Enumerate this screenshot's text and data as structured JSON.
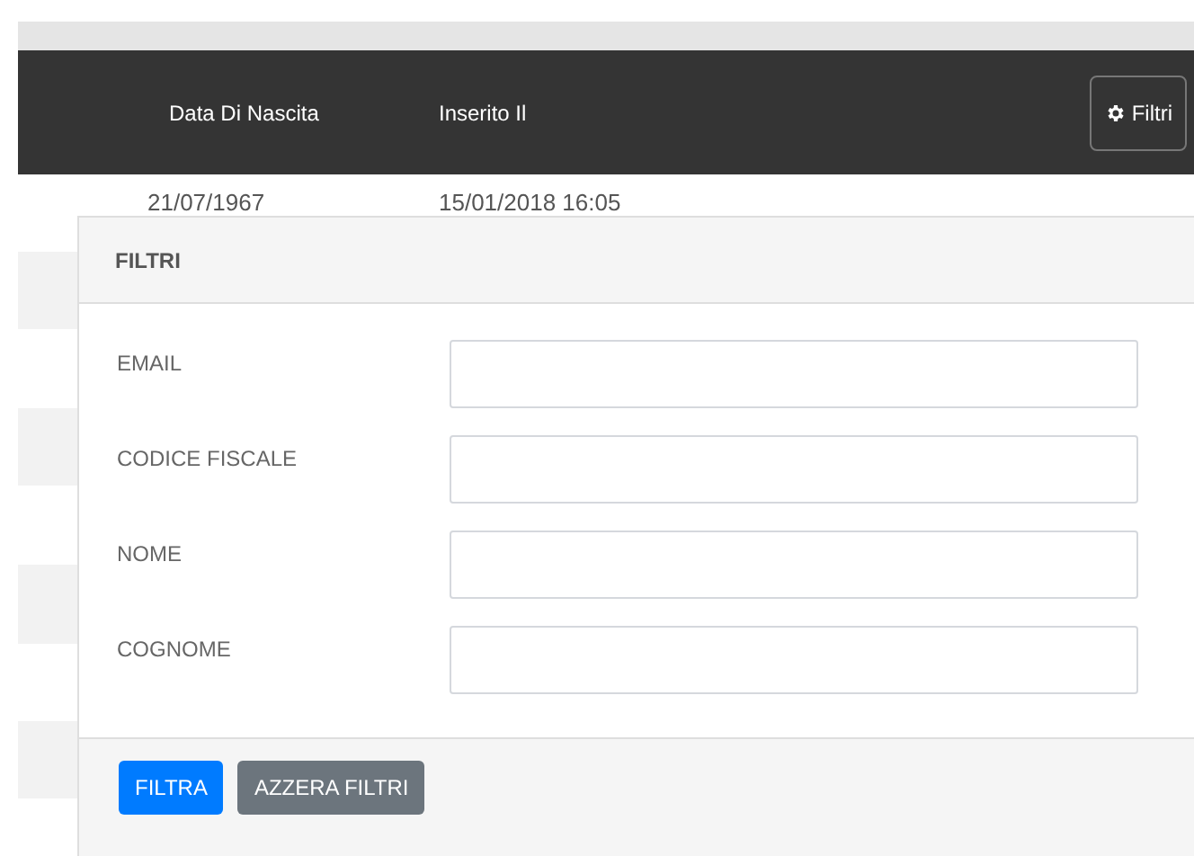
{
  "table": {
    "columns": [
      "Data Di Nascita",
      "Inserito Il"
    ],
    "filter_button": "Filtri",
    "rows": [
      {
        "cells": [
          "21/07/1967",
          "15/01/2018 16:05"
        ]
      }
    ]
  },
  "filter_panel": {
    "title": "FILTRI",
    "fields": [
      {
        "label": "EMAIL"
      },
      {
        "label": "CODICE FISCALE"
      },
      {
        "label": "NOME"
      },
      {
        "label": "COGNOME"
      }
    ],
    "buttons": [
      {
        "label": "FILTRA",
        "kind": "primary"
      },
      {
        "label": "AZZERA FILTRI",
        "kind": "secondary"
      }
    ]
  }
}
